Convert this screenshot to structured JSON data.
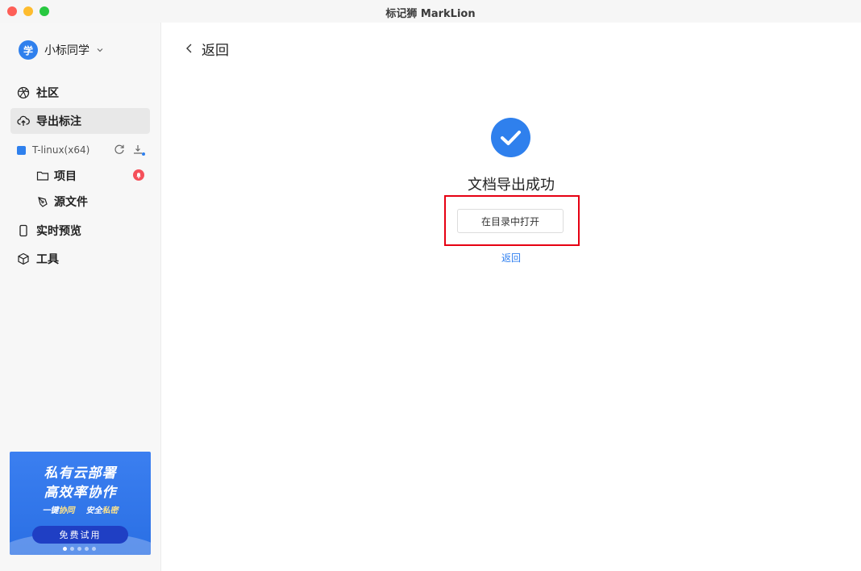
{
  "window": {
    "title": "标记狮 MarkLion"
  },
  "user": {
    "avatar_text": "学",
    "name": "小标同学"
  },
  "nav": {
    "community": "社区",
    "export": "导出标注",
    "preview": "实时预览",
    "tools": "工具"
  },
  "workspace": {
    "name": "T-linux(x64)",
    "color": "#2f80ed"
  },
  "tree": {
    "project": "项目",
    "source": "源文件"
  },
  "promo": {
    "title_line1": "私有云部署",
    "title_line2": "高效率协作",
    "tag1_prefix": "一键",
    "tag1_highlight": "协同",
    "tag2_prefix": "安全",
    "tag2_highlight": "私密",
    "button": "免费试用"
  },
  "main": {
    "back_label": "返回",
    "success_title": "文档导出成功",
    "open_button": "在目录中打开",
    "back_link": "返回"
  },
  "colors": {
    "accent": "#2f80ed",
    "highlight_border": "#e60012"
  }
}
